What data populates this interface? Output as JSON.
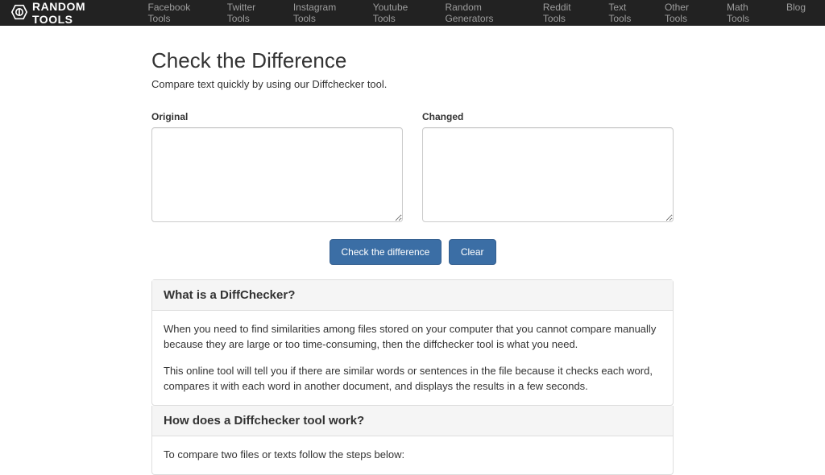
{
  "brand": "RANDOM TOOLS",
  "nav": {
    "items": [
      "Facebook Tools",
      "Twitter Tools",
      "Instagram Tools",
      "Youtube Tools",
      "Random Generators",
      "Reddit Tools",
      "Text Tools",
      "Other Tools",
      "Math Tools",
      "Blog"
    ]
  },
  "page": {
    "title": "Check the Difference",
    "subtitle": "Compare text quickly by using our Diffchecker tool."
  },
  "fields": {
    "original_label": "Original",
    "changed_label": "Changed",
    "original_value": "",
    "changed_value": ""
  },
  "buttons": {
    "check": "Check the difference",
    "clear": "Clear"
  },
  "panels": [
    {
      "heading": "What is a DiffChecker?",
      "paragraphs": [
        "When you need to find similarities among files stored on your computer that you cannot compare manually because they are large or too time-consuming, then the diffchecker tool is what you need.",
        "This online tool will tell you if there are similar words or sentences in the file because it checks each word, compares it with each word in another document, and displays the results in a few seconds."
      ]
    },
    {
      "heading": "How does a Diffchecker tool work?",
      "paragraphs": [
        "To compare two files or texts follow the steps below:"
      ]
    }
  ]
}
